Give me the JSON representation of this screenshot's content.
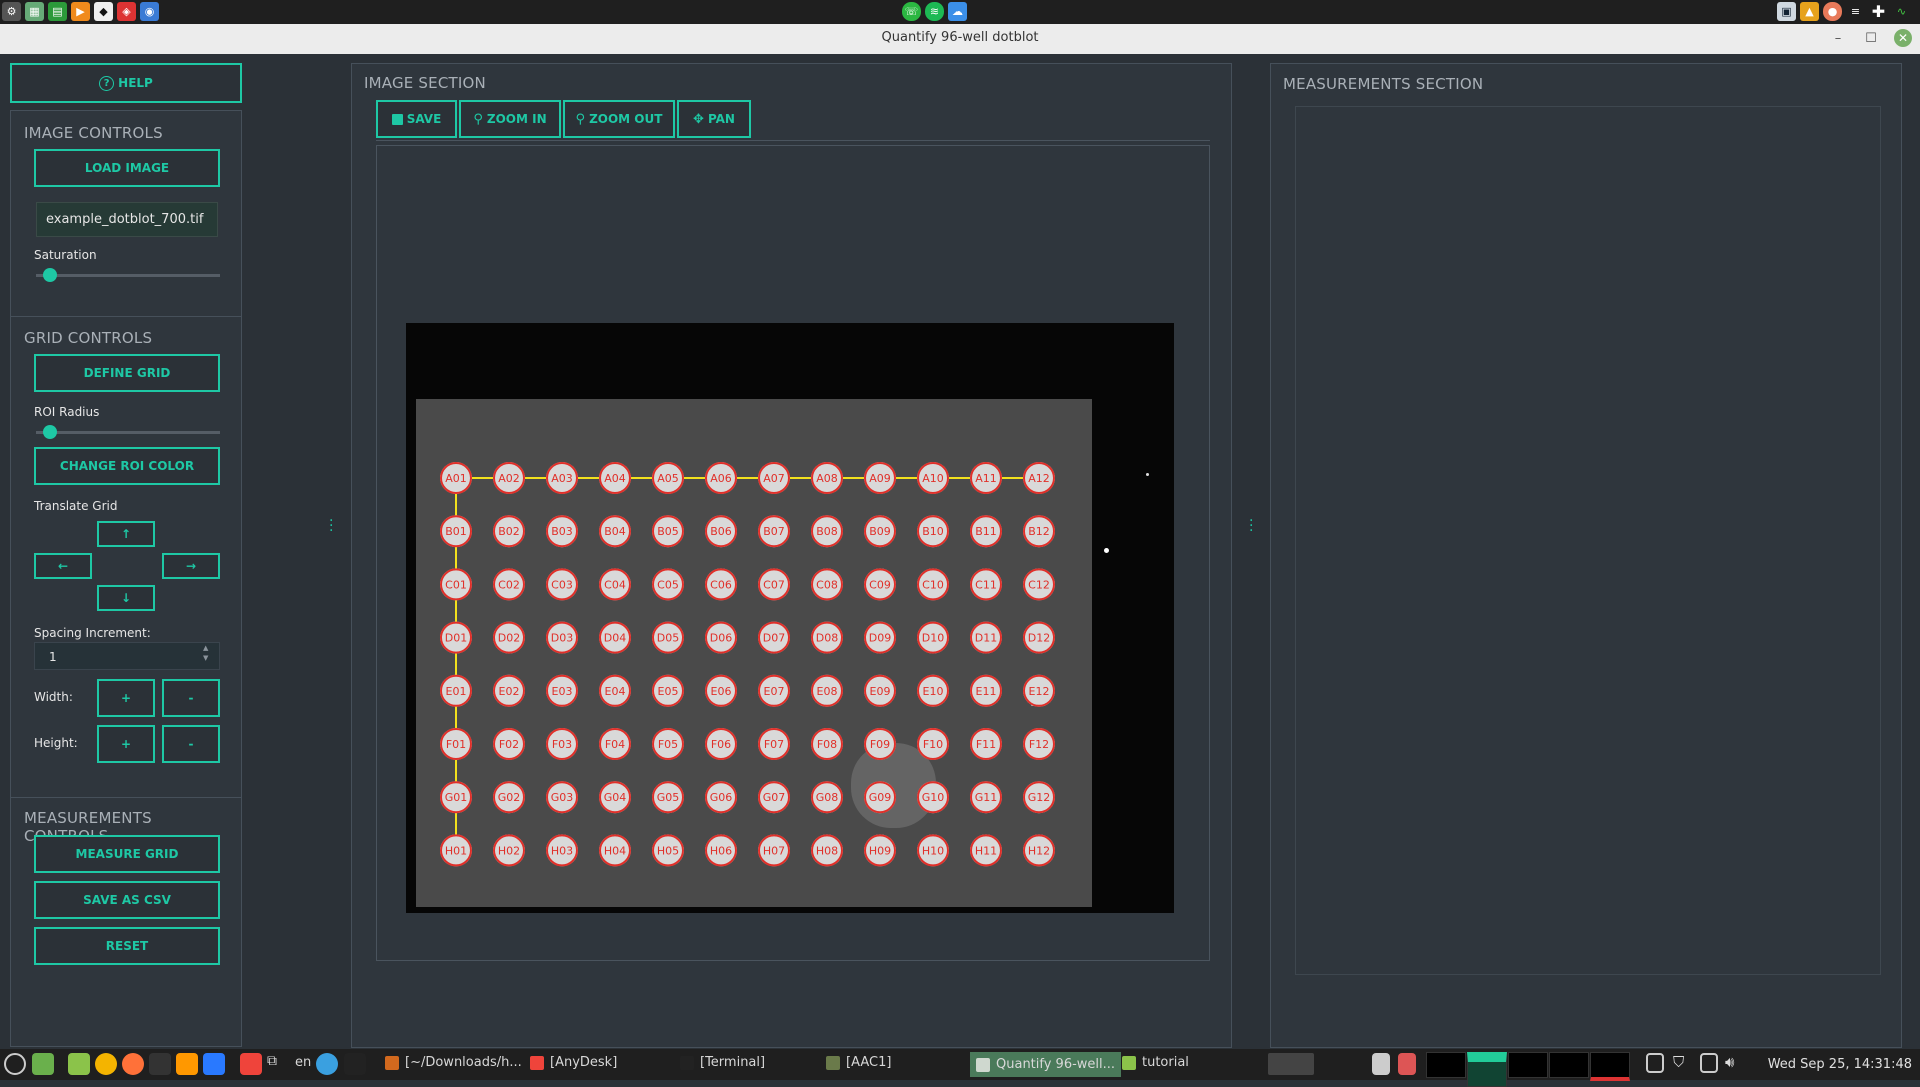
{
  "window": {
    "title": "Quantify 96-well dotblot"
  },
  "left": {
    "help_label": "HELP",
    "image_controls": {
      "title": "IMAGE CONTROLS",
      "load_label": "LOAD IMAGE",
      "filename": "example_dotblot_700.tif",
      "saturation_label": "Saturation",
      "saturation_value": 0.04
    },
    "grid_controls": {
      "title": "GRID CONTROLS",
      "define_label": "DEFINE GRID",
      "roi_radius_label": "ROI Radius",
      "roi_radius_value": 0.04,
      "change_color_label": "CHANGE ROI COLOR",
      "translate_label": "Translate Grid",
      "up": "↑",
      "left": "←",
      "right": "→",
      "down": "↓",
      "spacing_label": "Spacing Increment:",
      "spacing_value": "1",
      "width_label": "Width:",
      "height_label": "Height:",
      "plus": "+",
      "minus": "-"
    },
    "measurements_controls": {
      "title": "MEASUREMENTS CONTROLS",
      "measure_label": "MEASURE GRID",
      "save_csv_label": "SAVE AS CSV",
      "reset_label": "RESET"
    }
  },
  "image_section": {
    "title": "IMAGE SECTION",
    "toolbar": {
      "save": "SAVE",
      "zoom_in": "ZOOM IN",
      "zoom_out": "ZOOM OUT",
      "pan": "PAN"
    },
    "rows": [
      "A",
      "B",
      "C",
      "D",
      "E",
      "F",
      "G",
      "H"
    ],
    "cols": [
      "01",
      "02",
      "03",
      "04",
      "05",
      "06",
      "07",
      "08",
      "09",
      "10",
      "11",
      "12"
    ],
    "roi_color": "#e0302a",
    "grid_line_color": "#f2e11d"
  },
  "measurements_section": {
    "title": "MEASUREMENTS SECTION"
  },
  "taskbar": {
    "lang": "en",
    "tasks": [
      "[~/Downloads/h...",
      "[AnyDesk]",
      "[Terminal]",
      "[AAC1]",
      "Quantify 96-well...",
      "tutorial"
    ],
    "clock": "Wed Sep 25, 14:31:48"
  },
  "colors": {
    "accent": "#1ec8a5",
    "background": "#2b3137"
  }
}
